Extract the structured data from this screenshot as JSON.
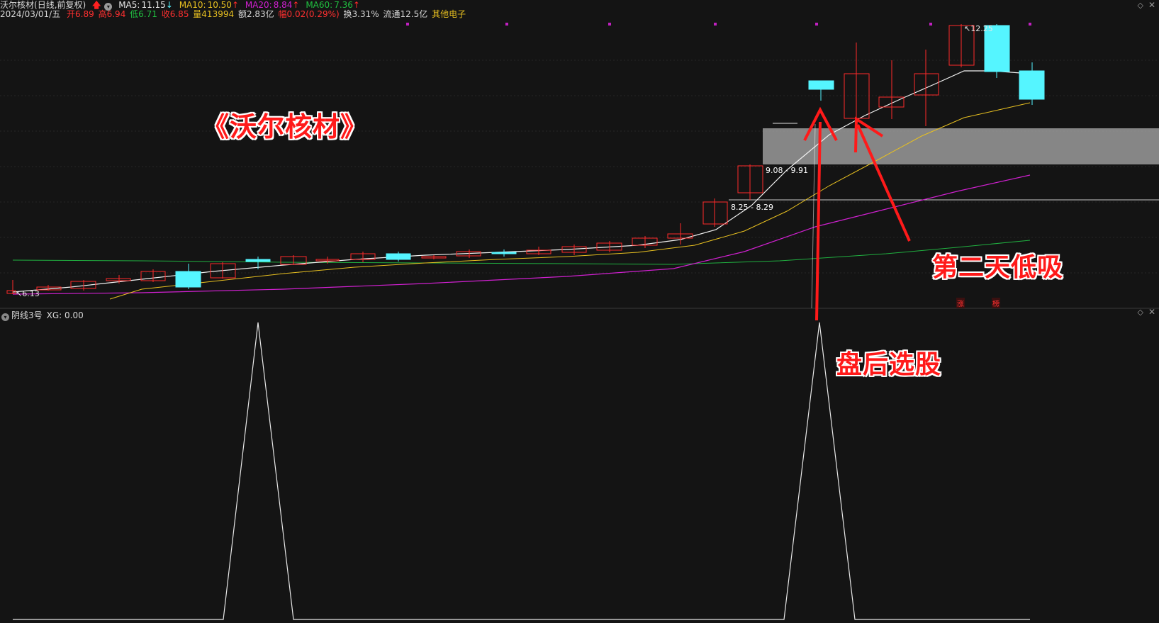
{
  "header": {
    "name": "沃尔核材",
    "mode": "(日线,前复权)",
    "ma5_label": "MA5:",
    "ma5": "11.15",
    "ma5_arrow": "↓",
    "ma10_label": "MA10:",
    "ma10": "10.50",
    "ma10_arrow": "↑",
    "ma20_label": "MA20:",
    "ma20": "8.84",
    "ma20_arrow": "↑",
    "ma60_label": "MA60:",
    "ma60": "7.36",
    "ma60_arrow": "↑"
  },
  "quote": {
    "date": "2024/03/01/五",
    "open": "开6.89",
    "high": "高6.94",
    "low": "低6.71",
    "close": "收6.85",
    "volume": "量413994",
    "amount": "额2.83亿",
    "amplitude": "幅0.02(0.29%)",
    "turnover": "换3.31%",
    "float_cap": "流通12.5亿",
    "sector": "其他电子"
  },
  "price_labels": {
    "low_mark": "6.13",
    "high_mark": "12.25",
    "zone_upper": "9.08 - 9.91",
    "zone_lower": "8.25 - 8.29"
  },
  "annotations": {
    "title": "《沃尔核材》",
    "second_day": "第二天低吸",
    "after_close": "盘后选股"
  },
  "tags": {
    "tag1": "涨",
    "tag2": "榜"
  },
  "indicator": {
    "title": "阴线3号",
    "xg": "XG: 0.00"
  },
  "colors": {
    "background": "#141414",
    "up": "#ff2a2a",
    "down": "#55f5ff",
    "ma5": "#ffffff",
    "ma10": "#e8c020",
    "ma20": "#d020d0",
    "ma60": "#20b040",
    "annotation": "#ff1a1a",
    "zone": "#a0a0a0"
  }
}
